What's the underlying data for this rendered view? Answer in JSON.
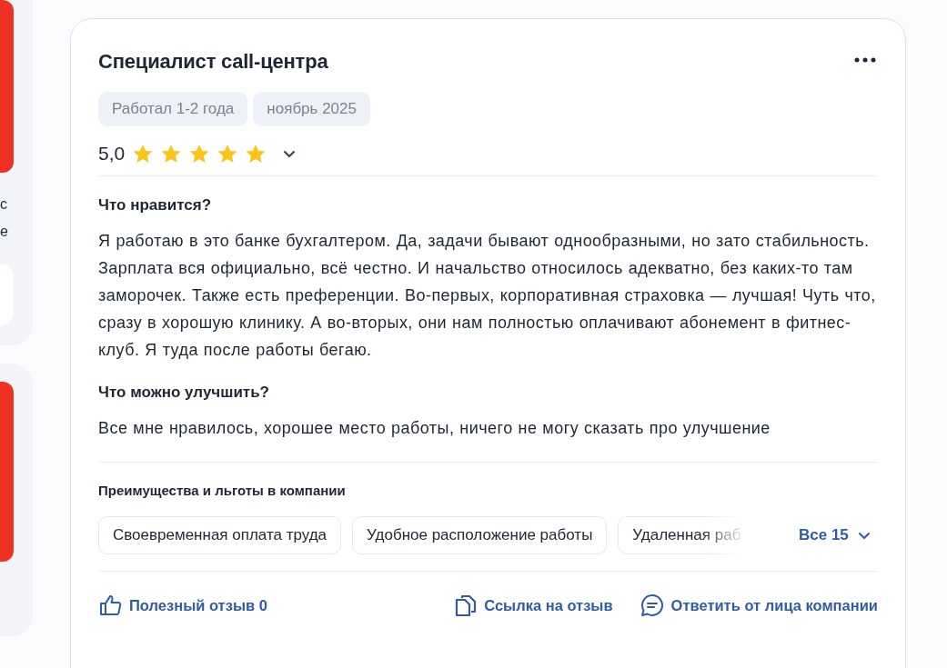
{
  "side_cards": [
    {
      "texts": [
        "с",
        "е"
      ],
      "has_inner_box": true
    },
    {
      "has_inner_box": false
    }
  ],
  "review": {
    "title": "Специалист call-центра",
    "tags": [
      "Работал 1-2 года",
      "ноябрь 2025"
    ],
    "rating": "5,0",
    "stars": 5,
    "expanded": false,
    "sections": [
      {
        "heading": "Что нравится?",
        "text": "Я работаю в это банке бухгалтером. Да, задачи бывают однообразными, но зато стабильность. Зарплата вся официально, всё честно. И начальство относилось адекватно, без каких-то там заморочек. Также есть преференции. Во-первых, корпоративная страховка — лучшая! Чуть что, сразу в хорошую клинику. А во-вторых, они нам полностью оплачивают абонемент в фитнес-клуб. Я туда после работы бегаю."
      },
      {
        "heading": "Что можно улучшить?",
        "text": "Все мне нравилось, хорошее место работы, ничего не могу сказать про улучшение"
      }
    ],
    "benefits_title": "Преимущества и льготы в компании",
    "benefits": [
      "Своевременная оплата труда",
      "Удобное расположение работы",
      "Удаленная раб"
    ],
    "benefits_more": "Все 15",
    "actions": [
      {
        "kind": "like",
        "label": "Полезный отзыв 0"
      },
      {
        "kind": "link",
        "label": "Ссылка на отзыв"
      },
      {
        "kind": "reply",
        "label": "Ответить от лица компании"
      }
    ]
  }
}
